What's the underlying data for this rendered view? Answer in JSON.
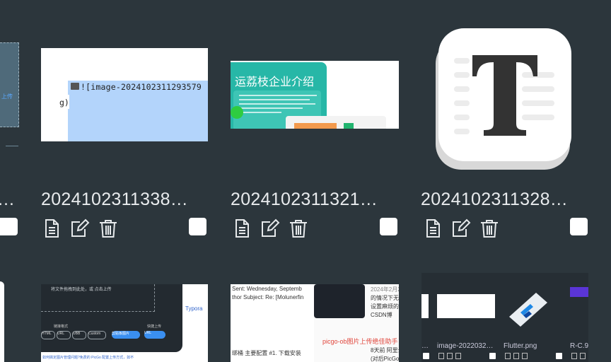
{
  "row1": [
    {
      "filename": "2024102311338…",
      "thumb_code_line1": "![image-2024102311293579",
      "thumb_code_line2": "g)"
    },
    {
      "filename": "2024102311321…",
      "thumb_title": "运荔枝企业介绍"
    },
    {
      "filename": "2024102311328…"
    }
  ],
  "left_partial": {
    "filename_tail": "…",
    "thumb_text": "上传"
  },
  "row2": {
    "card1": {
      "hint": "将文件拖拽到此处，或 点击上传",
      "label_left": "链接格式",
      "label_right": "快捷上传",
      "tabs": [
        "HTML",
        "URL",
        "UBB",
        "Custom"
      ],
      "buttons": [
        "剪贴板图片",
        "URL"
      ],
      "blue_text": "Typora",
      "bottom_text": "如何搞定图片管理问题?免费的 PicGo 配置上传方式，如不"
    },
    "card2": {
      "line1": "Sent: Wednesday, Septemb",
      "line2": "thor Subject: Re: [Molunerfin",
      "date": "2024年2月2",
      "side1": "的情况下无法",
      "side2": "设置麻烦的环",
      "source": "CSDN博",
      "red_title": "picgo-ob图片上传绝佳助手",
      "side3": "8天前 阿里云",
      "side4": "(对后PicGo",
      "bottom": "绑桶 主要配置 #1. 下载安装"
    },
    "card3": {
      "names": [
        "…",
        "image-2022032…",
        "Flutter.png",
        "R-C.9"
      ]
    }
  },
  "colors": {
    "background": "#2c363c",
    "filename_text": "#e8ebed",
    "checkbox": "#ffffff",
    "icon_stroke": "#e6e9eb"
  },
  "icons": [
    "document-icon",
    "edit-icon",
    "trash-icon"
  ]
}
